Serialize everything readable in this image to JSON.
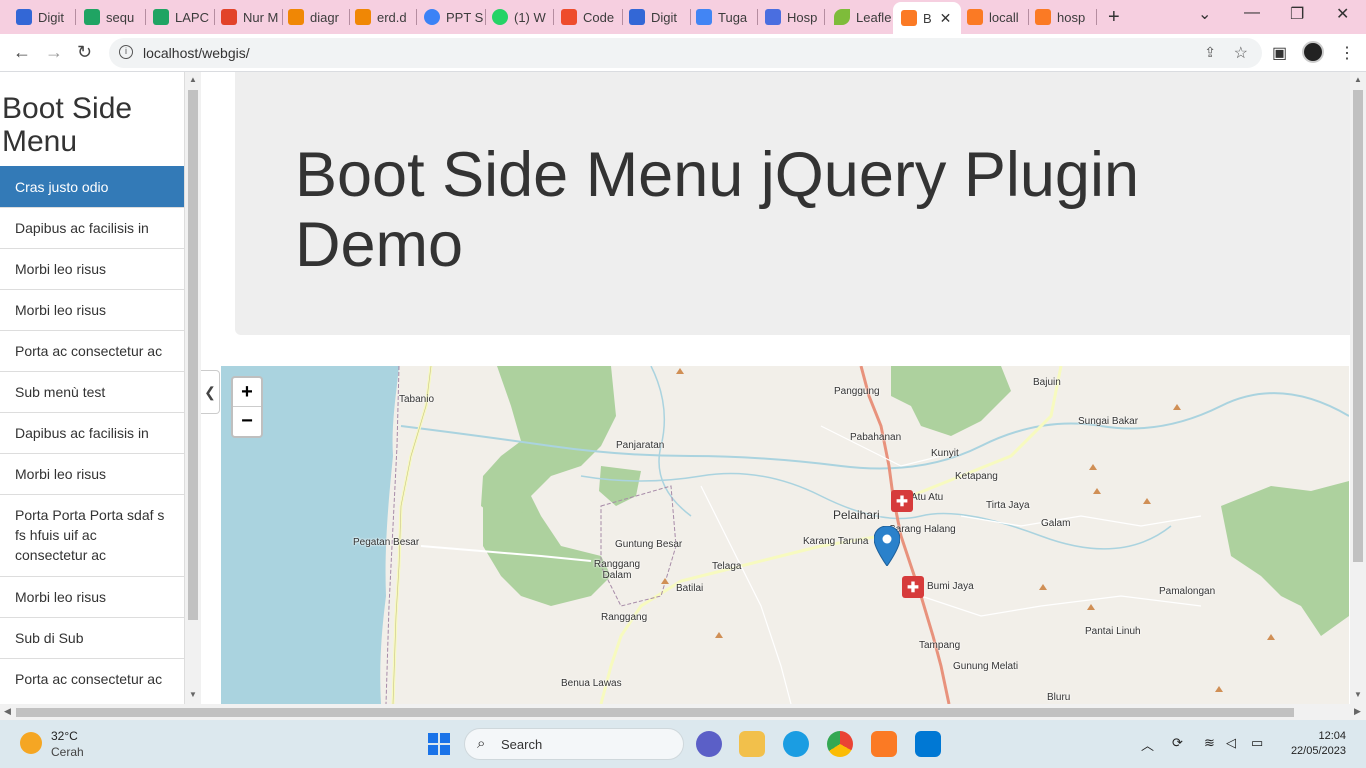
{
  "browser": {
    "tabs": [
      {
        "label": "Digit",
        "color": "#3367d6",
        "icon": "digital-icon"
      },
      {
        "label": "sequ",
        "color": "#1fa463",
        "icon": "google-drive-icon"
      },
      {
        "label": "LAPC",
        "color": "#1fa463",
        "icon": "google-drive-icon"
      },
      {
        "label": "Nur M",
        "color": "#e24329",
        "icon": "gitlab-icon"
      },
      {
        "label": "diagr",
        "color": "#f08705",
        "icon": "drawio-icon"
      },
      {
        "label": "erd.d",
        "color": "#f08705",
        "icon": "drawio-icon"
      },
      {
        "label": "PPT S",
        "color": "#3b82f6",
        "icon": "canva-icon"
      },
      {
        "label": "(1) W",
        "color": "#25d366",
        "icon": "whatsapp-icon"
      },
      {
        "label": "Code",
        "color": "#ee4c2c",
        "icon": "codeigniter-icon"
      },
      {
        "label": "Digit",
        "color": "#3367d6",
        "icon": "digital-icon"
      },
      {
        "label": "Tuga",
        "color": "#4285f4",
        "icon": "classroom-icon"
      },
      {
        "label": "Hosp",
        "color": "#4a6ee0",
        "icon": "info-icon"
      },
      {
        "label": "Leafle",
        "color": "#7ebc3a",
        "icon": "leaflet-icon"
      },
      {
        "label": "B",
        "color": "#fb7a24",
        "icon": "xampp-icon"
      },
      {
        "label": "locall",
        "color": "#fb7a24",
        "icon": "xampp-icon"
      },
      {
        "label": "hosp",
        "color": "#fb7a24",
        "icon": "xampp-icon"
      }
    ],
    "url": "localhost/webgis/"
  },
  "sidebar": {
    "title": "Boot Side Menu",
    "items": [
      {
        "label": "Cras justo odio"
      },
      {
        "label": "Dapibus ac facilisis in"
      },
      {
        "label": "Morbi leo risus"
      },
      {
        "label": "Morbi leo risus"
      },
      {
        "label": "Porta ac consectetur ac"
      },
      {
        "label": "Sub menù test"
      },
      {
        "label": "Dapibus ac facilisis in"
      },
      {
        "label": "Morbi leo risus"
      },
      {
        "label": "Porta Porta Porta sdaf s fs hfuis uif ac consectetur ac"
      },
      {
        "label": "Morbi leo risus"
      },
      {
        "label": "Sub di Sub"
      },
      {
        "label": "Porta ac consectetur ac"
      }
    ]
  },
  "jumbotron": {
    "title": "Boot Side Menu jQuery Plugin Demo"
  },
  "map": {
    "zoom_in": "+",
    "zoom_out": "−",
    "labels": [
      "Tabanio",
      "Panggung",
      "Bajuin",
      "Pabahanan",
      "Sungai Bakar",
      "Panjaratan",
      "Kunyit",
      "Ketapang",
      "Pelaihari",
      "Atu Atu",
      "Tirta Jaya",
      "Sarang Halang",
      "Galam",
      "Pegatan Besar",
      "Guntung Besar",
      "Karang Taruna",
      "Ranggang Dalam",
      "Telaga",
      "Batilai",
      "Bumi Jaya",
      "Pamalongan",
      "Ranggang",
      "Pantai Linuh",
      "Tampang",
      "Gunung Melati",
      "Benua Lawas",
      "Bluru"
    ]
  },
  "taskbar": {
    "temperature": "32°C",
    "weather": "Cerah",
    "search_label": "Search",
    "time": "12:04",
    "date": "22/05/2023"
  }
}
